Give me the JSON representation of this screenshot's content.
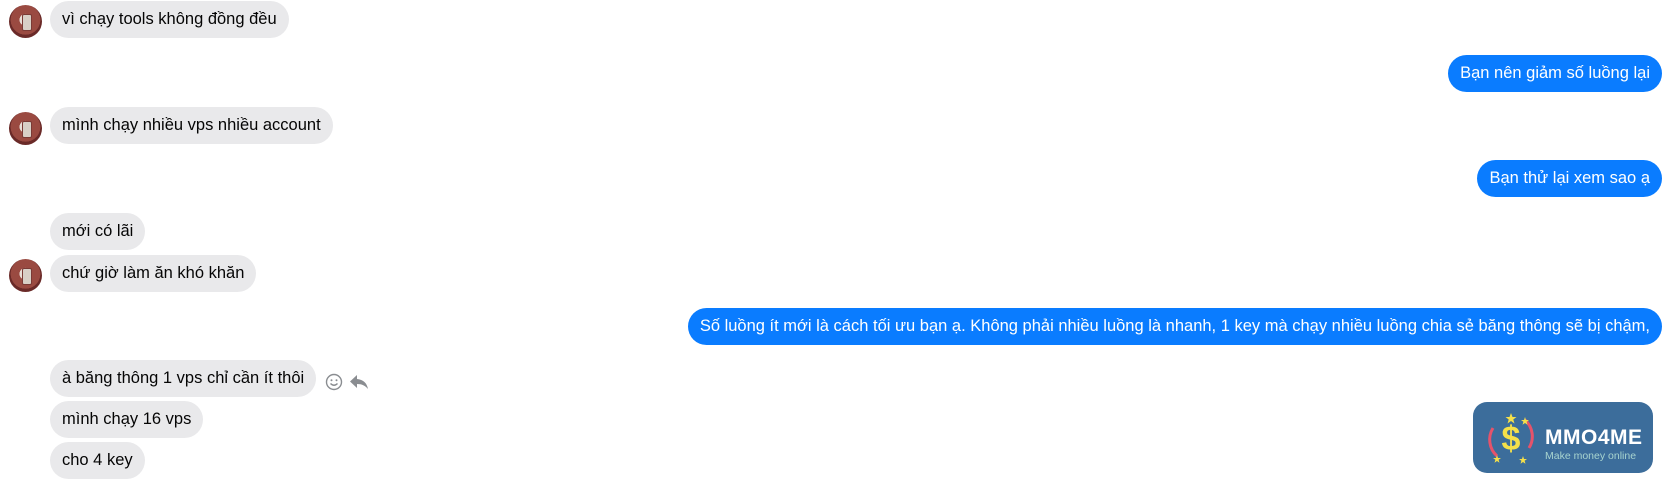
{
  "conversation": {
    "messages": [
      {
        "side": "in",
        "text": "vì chạy tools không đồng đều"
      },
      {
        "side": "out",
        "text": "Bạn nên giảm số luồng lại"
      },
      {
        "side": "in",
        "text": "mình chạy nhiều vps nhiều account"
      },
      {
        "side": "out",
        "text": "Bạn thử lại xem sao ạ"
      },
      {
        "side": "in",
        "text": "mới có lãi"
      },
      {
        "side": "in",
        "text": "chứ giờ làm ăn khó khăn"
      },
      {
        "side": "out",
        "text": "Số luồng ít mới là cách tối ưu bạn ạ. Không phải nhiều luồng là nhanh, 1 key mà chạy nhiều luồng chia sẻ băng  thông sẽ bị chậm,"
      },
      {
        "side": "in",
        "text": "à băng thông 1 vps chỉ cần ít thôi"
      },
      {
        "side": "in",
        "text": "mình chạy 16 vps"
      },
      {
        "side": "in",
        "text": "cho 4 key"
      }
    ],
    "colors": {
      "incoming_bg": "#e9e9eb",
      "outgoing_bg": "#0a7cff",
      "outgoing_text": "#ffffff"
    },
    "message_actions": [
      "smiley-icon",
      "reply-icon"
    ]
  },
  "watermark": {
    "title": "MMO4ME",
    "subtitle": "Make money online",
    "icon": "dollar-coin-icon"
  }
}
